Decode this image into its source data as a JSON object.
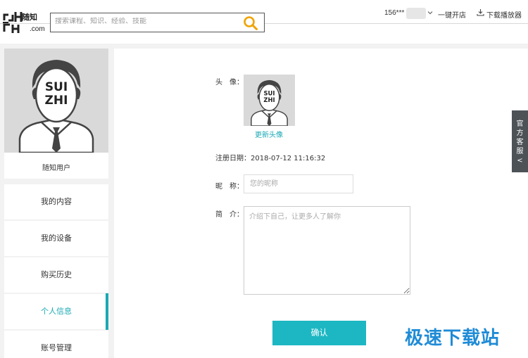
{
  "header": {
    "logo_text": "随知",
    "logo_domain": ".com",
    "search_placeholder": "搜索课程、知识、经验、技能",
    "user_name": "156***",
    "open_shop": "一键开店",
    "download_player": "下载播放器"
  },
  "sidebar": {
    "profile_name": "随知用户",
    "menu": [
      {
        "label": "我的内容"
      },
      {
        "label": "我的设备"
      },
      {
        "label": "购买历史"
      },
      {
        "label": "个人信息"
      },
      {
        "label": "账号管理"
      }
    ],
    "active_index": 3
  },
  "form": {
    "avatar_label": "头　像：",
    "change_avatar": "更新头像",
    "reg_date_label": "注册日期：",
    "reg_date_value": "2018-07-12 11:16:32",
    "nickname_label": "昵　称：",
    "nickname_placeholder": "您的昵称",
    "bio_label": "简　介：",
    "bio_placeholder": "介绍下自己，让更多人了解你",
    "confirm_label": "确认"
  },
  "service_tab": {
    "label": "官方客服",
    "arrow": "<"
  },
  "watermark": "极速下载站",
  "colors": {
    "accent": "#1aa9b5",
    "button": "#1cb7c3",
    "search_icon": "#f0a300",
    "avatar_bg": "#d9d9d9",
    "service_bg": "#4d5257"
  }
}
